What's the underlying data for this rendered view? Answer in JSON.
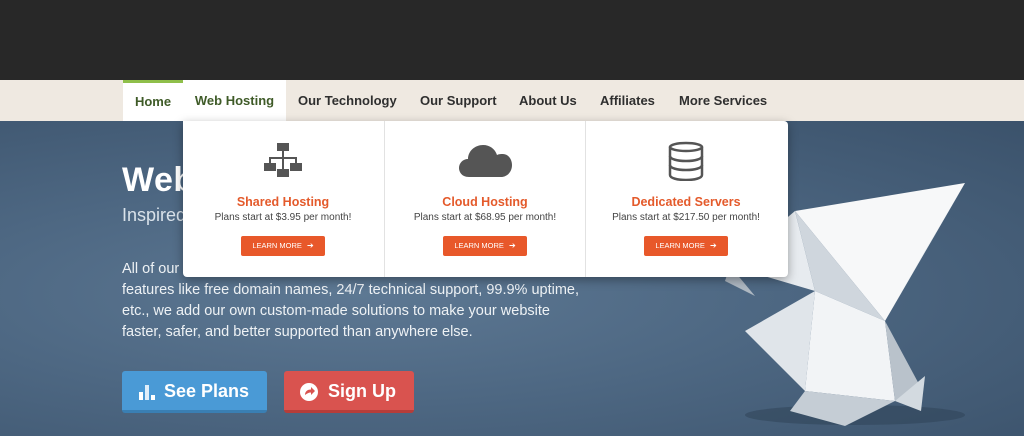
{
  "nav": {
    "items": [
      {
        "label": "Home"
      },
      {
        "label": "Web Hosting"
      },
      {
        "label": "Our Technology"
      },
      {
        "label": "Our Support"
      },
      {
        "label": "About Us"
      },
      {
        "label": "Affiliates"
      },
      {
        "label": "More Services"
      }
    ]
  },
  "dropdown": {
    "columns": [
      {
        "icon": "network-icon",
        "title": "Shared Hosting",
        "subtitle": "Plans start at $3.95 per month!",
        "button": "LEARN MORE"
      },
      {
        "icon": "cloud-icon",
        "title": "Cloud Hosting",
        "subtitle": "Plans start at $68.95 per month!",
        "button": "LEARN MORE"
      },
      {
        "icon": "database-icon",
        "title": "Dedicated Servers",
        "subtitle": "Plans start at $217.50 per month!",
        "button": "LEARN MORE"
      }
    ]
  },
  "hero": {
    "title": "Web",
    "subtitle": "Inspired",
    "body_start": "All of our",
    "body_rest": "features like free domain names, 24/7 technical support, 99.9% uptime, etc., we add our own custom-made solutions to make your website faster, safer, and better supported than anywhere else.",
    "see_plans": "See Plans",
    "sign_up": "Sign Up"
  },
  "colors": {
    "accent_orange": "#e8582a",
    "nav_active_green": "#3f5b28",
    "plans_blue": "#4a9ad6",
    "signup_red": "#d9534f"
  }
}
